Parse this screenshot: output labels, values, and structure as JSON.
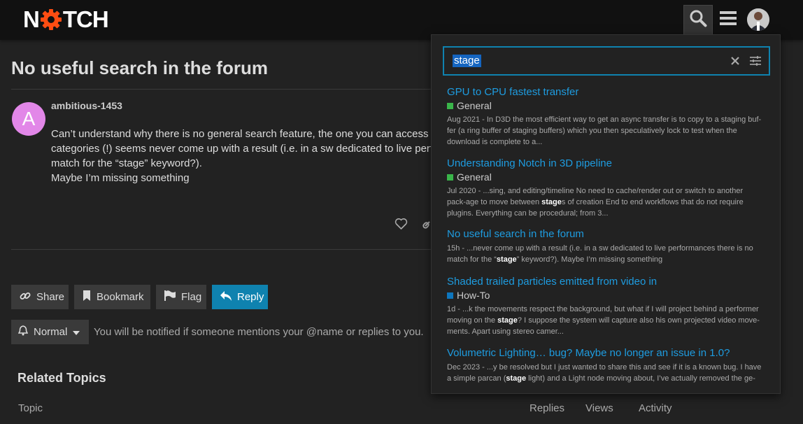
{
  "header": {
    "logo_text_before": "N",
    "logo_text_after": "TCH",
    "brand_color": "#ff4d12",
    "search_icon": "search-icon",
    "menu_icon": "hamburger-icon"
  },
  "topic": {
    "title": "No useful search in the forum",
    "post": {
      "avatar_letter": "A",
      "avatar_color": "#e287e8",
      "username": "ambitious-1453",
      "line1": "Can’t understand why there is no general search feature, the one you can access se",
      "line2": "categories (!) seems never come up with a result (i.e. in a sw dedicated to live perfo",
      "line3": "match for the “stage” keyword?).",
      "line4": "Maybe I’m missing something"
    },
    "buttons": {
      "share": "Share",
      "bookmark": "Bookmark",
      "flag": "Flag",
      "reply": "Reply"
    },
    "notification": {
      "level": "Normal",
      "description": "You will be notified if someone mentions your @name or replies to you."
    }
  },
  "related": {
    "title": "Related Topics",
    "columns": [
      "Topic",
      "Replies",
      "Views",
      "Activity"
    ]
  },
  "search": {
    "query": "stage",
    "results": [
      {
        "title": "GPU to CPU fastest transfer",
        "category": "General",
        "category_color": "#3ab54a",
        "blurb_before": "Aug 2021 - In D3D the most efficient way to get an async transfer is to copy to a staging buf-fer (a ring buffer of staging buffers) which you then speculatively lock to test when the download is complete to a...",
        "highlight": "",
        "blurb_after": ""
      },
      {
        "title": "Understanding Notch in 3D pipeline",
        "category": "General",
        "category_color": "#3ab54a",
        "blurb_before": "Jul 2020 - ...sing, and editing/timeline No need to cache/render out or switch to another pack-age to move between ",
        "highlight": "stage",
        "blurb_after": "s of creation End to end workflows that do not require plugins. Everything can be procedural; from 3..."
      },
      {
        "title": "No useful search in the forum",
        "category": "",
        "category_color": "",
        "blurb_before": "15h - ...never come up with a result (i.e. in a sw dedicated to live performances there is no match for the “",
        "highlight": "stage",
        "blurb_after": "” keyword?). Maybe I’m missing something"
      },
      {
        "title": "Shaded trailed particles emitted from video in",
        "category": "How-To",
        "category_color": "#0e76bd",
        "blurb_before": "1d - ...k the movements respect the background, but what if I will project behind a performer moving on the ",
        "highlight": "stage",
        "blurb_after": "? I suppose the system will capture also his own projected video move-ments. Apart using stereo camer..."
      },
      {
        "title": "Volumetric Lighting… bug? Maybe no longer an issue in 1.0?",
        "category": "",
        "category_color": "",
        "blurb_before": "Dec 2023 - ...y be resolved but I just wanted to share this and see if it is a known bug. I have a simple parcan (",
        "highlight": "stage",
        "blurb_after": " light) and a Light node moving about, I’ve actually removed the ge-"
      }
    ]
  }
}
